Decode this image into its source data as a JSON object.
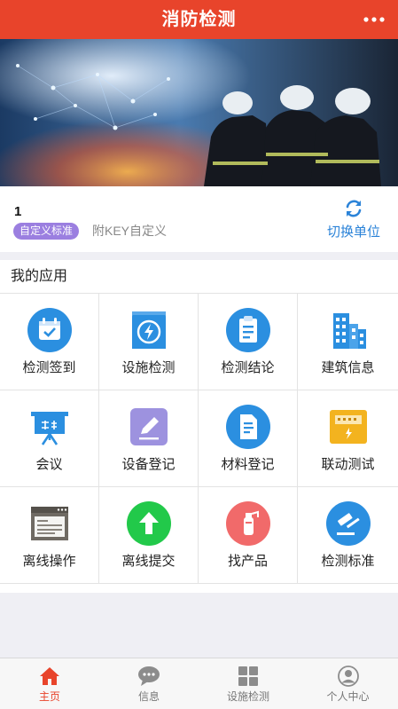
{
  "header": {
    "title": "消防检测"
  },
  "unit": {
    "name": "1",
    "tag": "自定义标准",
    "note": "附KEY自定义",
    "switch_label": "切换单位"
  },
  "apps": {
    "title": "我的应用",
    "items": [
      {
        "label": "检测签到",
        "icon": "calendar-check-icon"
      },
      {
        "label": "设施检测",
        "icon": "lightning-icon"
      },
      {
        "label": "检测结论",
        "icon": "clipboard-icon"
      },
      {
        "label": "建筑信息",
        "icon": "building-icon"
      },
      {
        "label": "会议",
        "icon": "presentation-icon"
      },
      {
        "label": "设备登记",
        "icon": "edit-icon"
      },
      {
        "label": "材料登记",
        "icon": "document-icon"
      },
      {
        "label": "联动测试",
        "icon": "control-panel-icon"
      },
      {
        "label": "离线操作",
        "icon": "browser-window-icon"
      },
      {
        "label": "离线提交",
        "icon": "upload-arrow-icon"
      },
      {
        "label": "找产品",
        "icon": "fire-extinguisher-icon"
      },
      {
        "label": "检测标准",
        "icon": "gavel-icon"
      }
    ]
  },
  "tabbar": {
    "items": [
      {
        "label": "主页",
        "icon": "home-icon",
        "active": true
      },
      {
        "label": "信息",
        "icon": "message-icon",
        "active": false
      },
      {
        "label": "设施检测",
        "icon": "grid-icon",
        "active": false
      },
      {
        "label": "个人中心",
        "icon": "user-icon",
        "active": false
      }
    ]
  },
  "colors": {
    "primary": "#e8442b",
    "link": "#2b83d8",
    "tag": "#9b7fe0"
  }
}
